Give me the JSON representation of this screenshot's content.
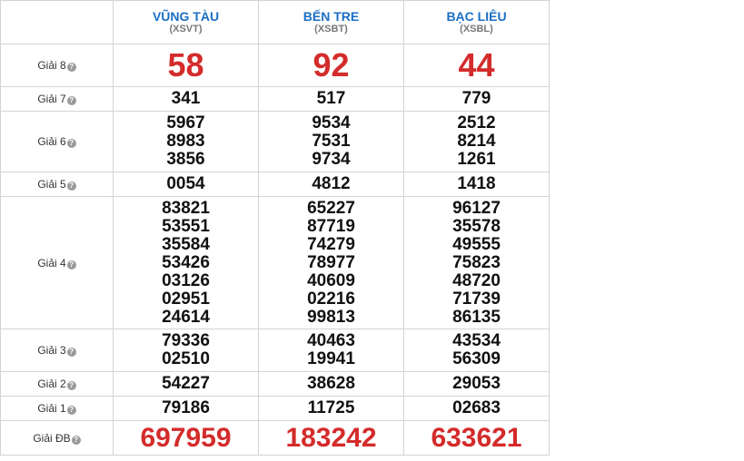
{
  "provinces": [
    {
      "name": "VŨNG TÀU",
      "code": "(XSVT)"
    },
    {
      "name": "BẾN TRE",
      "code": "(XSBT)"
    },
    {
      "name": "BẠC LIÊU",
      "code": "(XSBL)"
    }
  ],
  "help_glyph": "?",
  "prizes": [
    {
      "key": "g8",
      "label": "Giải 8",
      "style": "big",
      "values": [
        [
          "58"
        ],
        [
          "92"
        ],
        [
          "44"
        ]
      ]
    },
    {
      "key": "g7",
      "label": "Giải 7",
      "style": "num",
      "values": [
        [
          "341"
        ],
        [
          "517"
        ],
        [
          "779"
        ]
      ]
    },
    {
      "key": "g6",
      "label": "Giải 6",
      "style": "num",
      "values": [
        [
          "5967",
          "8983",
          "3856"
        ],
        [
          "9534",
          "7531",
          "9734"
        ],
        [
          "2512",
          "8214",
          "1261"
        ]
      ]
    },
    {
      "key": "g5",
      "label": "Giải 5",
      "style": "num",
      "values": [
        [
          "0054"
        ],
        [
          "4812"
        ],
        [
          "1418"
        ]
      ]
    },
    {
      "key": "g4",
      "label": "Giải 4",
      "style": "num",
      "values": [
        [
          "83821",
          "53551",
          "35584",
          "53426",
          "03126",
          "02951",
          "24614"
        ],
        [
          "65227",
          "87719",
          "74279",
          "78977",
          "40609",
          "02216",
          "99813"
        ],
        [
          "96127",
          "35578",
          "49555",
          "75823",
          "48720",
          "71739",
          "86135"
        ]
      ]
    },
    {
      "key": "g3",
      "label": "Giải 3",
      "style": "num",
      "values": [
        [
          "79336",
          "02510"
        ],
        [
          "40463",
          "19941"
        ],
        [
          "43534",
          "56309"
        ]
      ]
    },
    {
      "key": "g2",
      "label": "Giải 2",
      "style": "num",
      "values": [
        [
          "54227"
        ],
        [
          "38628"
        ],
        [
          "29053"
        ]
      ]
    },
    {
      "key": "g1",
      "label": "Giải 1",
      "style": "num",
      "values": [
        [
          "79186"
        ],
        [
          "11725"
        ],
        [
          "02683"
        ]
      ]
    },
    {
      "key": "gdb",
      "label": "Giải ĐB",
      "style": "db",
      "values": [
        [
          "697959"
        ],
        [
          "183242"
        ],
        [
          "633621"
        ]
      ]
    }
  ]
}
